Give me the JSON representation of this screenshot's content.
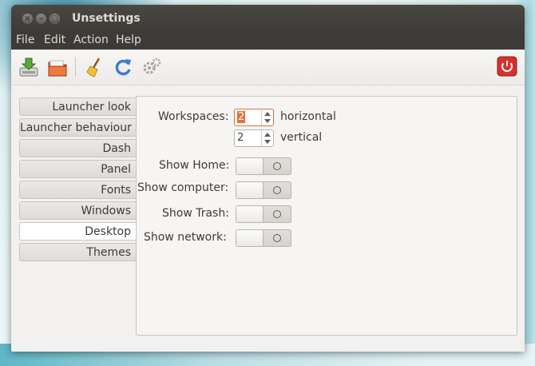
{
  "window": {
    "title": "Unsettings"
  },
  "window_buttons": [
    {
      "name": "close",
      "glyph": "×"
    },
    {
      "name": "minimize",
      "glyph": "–"
    },
    {
      "name": "maximize",
      "glyph": "□"
    }
  ],
  "menu": [
    "File",
    "Edit",
    "Action",
    "Help"
  ],
  "toolbar": {
    "icons": [
      "save-icon",
      "open-folder-icon",
      "broom-icon",
      "refresh-icon",
      "gears-icon",
      "power-icon"
    ]
  },
  "tabs": [
    {
      "label": "Launcher look",
      "active": false
    },
    {
      "label": "Launcher behaviour",
      "active": false
    },
    {
      "label": "Dash",
      "active": false
    },
    {
      "label": "Panel",
      "active": false
    },
    {
      "label": "Fonts",
      "active": false
    },
    {
      "label": "Windows",
      "active": false
    },
    {
      "label": "Desktop",
      "active": true
    },
    {
      "label": "Themes",
      "active": false
    }
  ],
  "desktop": {
    "workspaces_label": "Workspaces:",
    "horizontal_value": "2",
    "horizontal_label": "horizontal",
    "vertical_value": "2",
    "vertical_label": "vertical",
    "toggles": [
      {
        "label": "Show Home:",
        "state": "off"
      },
      {
        "label": "Show computer:",
        "state": "off"
      },
      {
        "label": "Show Trash:",
        "state": "off"
      },
      {
        "label": "Show network:",
        "state": "off"
      }
    ]
  },
  "colors": {
    "accent": "#e46f38",
    "titlebar": "#3c3b37",
    "power": "#d9302c"
  }
}
